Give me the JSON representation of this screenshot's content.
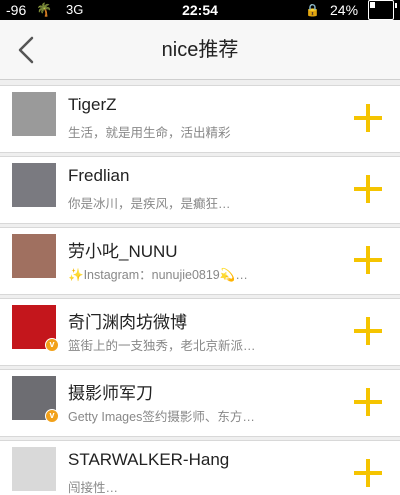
{
  "status_bar": {
    "signal": "-96",
    "network": "3G",
    "time": "22:54",
    "battery_percent": "24%",
    "battery_level": 0.24
  },
  "header": {
    "title": "nice推荐"
  },
  "colors": {
    "accent": "#f5c400",
    "badge": "#f2a11a"
  },
  "users": [
    {
      "name": "TigerZ",
      "bio": "生活，就是用生命，活出精彩",
      "verified": false,
      "avatar_color": "#9a9a9a"
    },
    {
      "name": "Fredlian",
      "bio": "你是冰川，是疾风，是癫狂…",
      "verified": false,
      "avatar_color": "#7a7a80"
    },
    {
      "name": "劳小叱_NUNU",
      "bio": "✨Instagram：nunujie0819💫…",
      "verified": false,
      "avatar_color": "#a07060"
    },
    {
      "name": "奇门渊肉坊微博",
      "bio": "篮街上的一支独秀，老北京新派…",
      "verified": true,
      "avatar_color": "#c4161c"
    },
    {
      "name": "摄影师军刀",
      "bio": "Getty Images签约摄影师、东方…",
      "verified": true,
      "avatar_color": "#6d6d72"
    },
    {
      "name": "STARWALKER-Hang",
      "bio": "闯接性…",
      "verified": false,
      "avatar_color": "#d9d9d9"
    }
  ]
}
